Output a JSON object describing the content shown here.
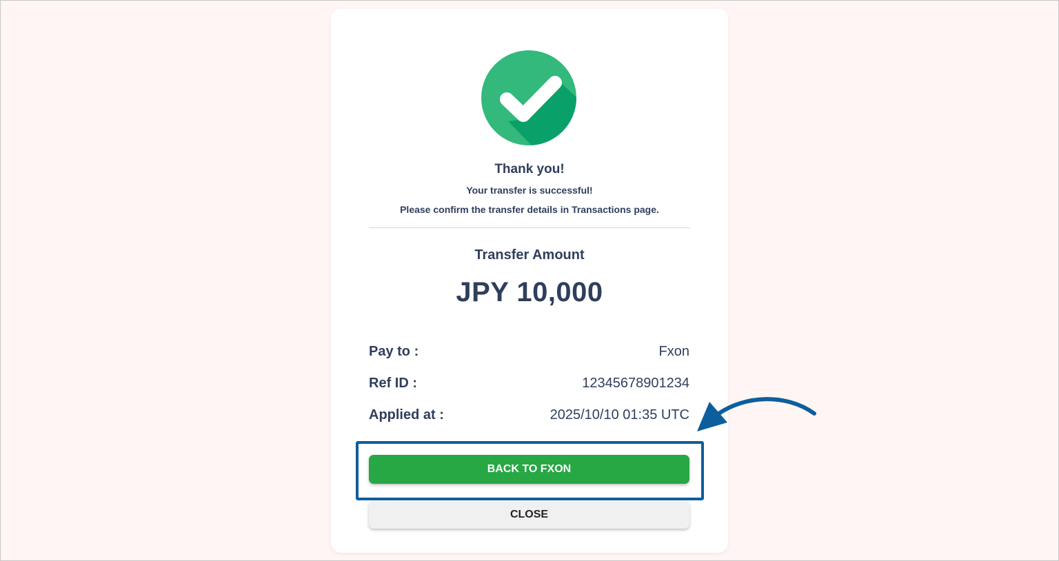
{
  "colors": {
    "accent_green": "#28a745",
    "check_green": "#33b97b",
    "text_navy": "#2f3e5c",
    "annotation_blue": "#0d5e9c"
  },
  "status": {
    "icon": "check-circle-icon",
    "title": "Thank you!",
    "line1": "Your transfer is successful!",
    "line2": "Please confirm the transfer details in Transactions page."
  },
  "transfer": {
    "label": "Transfer Amount",
    "amount": "JPY 10,000"
  },
  "details": [
    {
      "key": "Pay to :",
      "value": "Fxon"
    },
    {
      "key": "Ref ID :",
      "value": "12345678901234"
    },
    {
      "key": "Applied at :",
      "value": "2025/10/10 01:35 UTC"
    }
  ],
  "actions": {
    "primary_label": "BACK TO FXON",
    "secondary_label": "CLOSE"
  },
  "annotation": {
    "icon": "arrow-annotation-icon"
  }
}
